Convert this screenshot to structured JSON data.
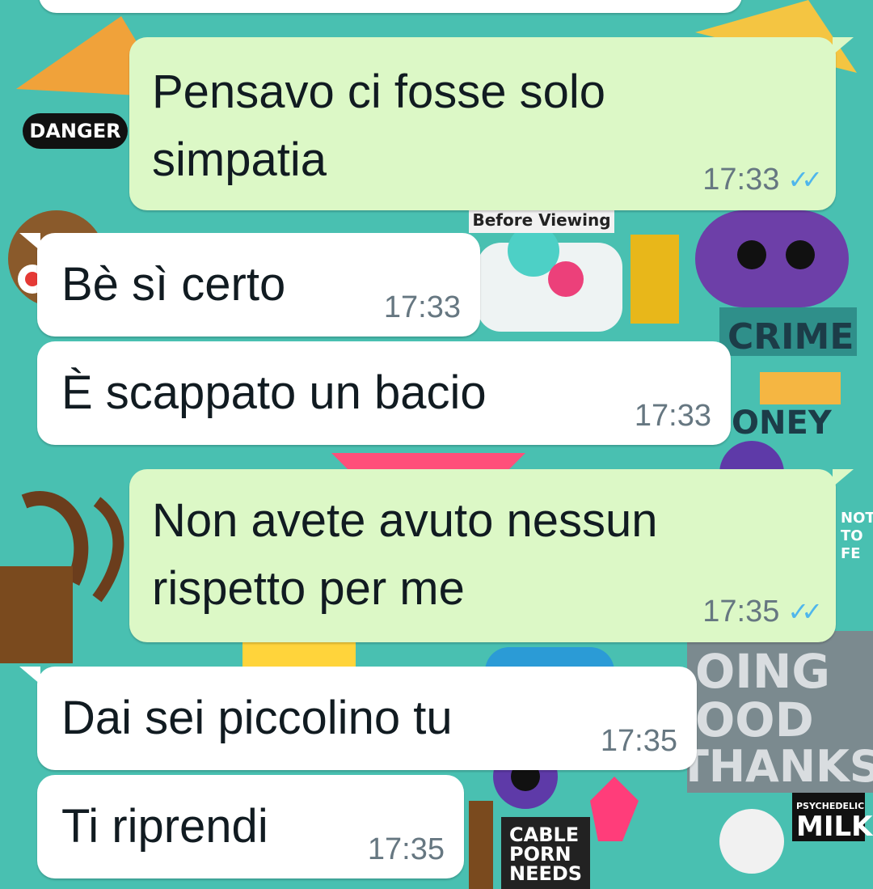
{
  "colors": {
    "wallpaper": "#49c0b1",
    "incoming_bubble": "#ffffff",
    "outgoing_bubble": "#dcf8c6",
    "timestamp": "#667781",
    "read_ticks": "#4fb6ec"
  },
  "wallpaper_stickers": {
    "danger": "DANGER",
    "before_viewing": "Before Viewing",
    "crime": "CRIME",
    "oney": "ONEY",
    "nothing_to_fear": "NOTH TO FE",
    "doing_good": "OING OOD",
    "thanks": "THANKS",
    "psychedelic": "PSYCHEDELIC",
    "milk": "MILK",
    "cable": "CABLE",
    "porn": "PORN",
    "needs": "NEEDS"
  },
  "messages": [
    {
      "direction": "out",
      "text": "Pensavo ci fosse solo\nsimpatia",
      "time": "17:33",
      "status_icon": "double-check-icon"
    },
    {
      "direction": "in",
      "text": "Bè sì certo",
      "time": "17:33"
    },
    {
      "direction": "in",
      "text": "È scappato un bacio",
      "time": "17:33"
    },
    {
      "direction": "out",
      "text": "Non avete avuto nessun\nrispetto per me",
      "time": "17:35",
      "status_icon": "double-check-icon"
    },
    {
      "direction": "in",
      "text": "Dai sei piccolino tu",
      "time": "17:35"
    },
    {
      "direction": "in",
      "text": "Ti riprendi",
      "time": "17:35"
    }
  ]
}
